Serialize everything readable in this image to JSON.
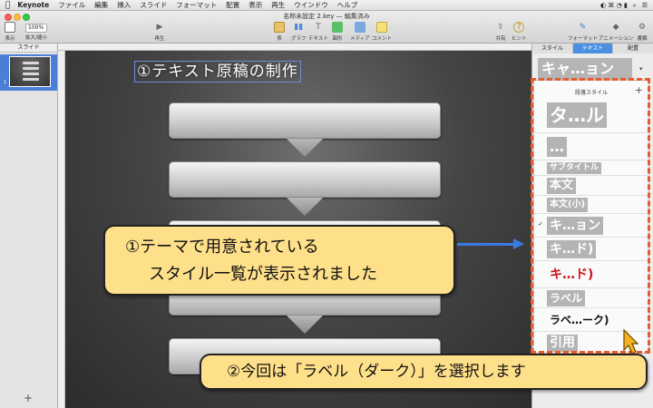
{
  "menubar": {
    "app": "Keynote",
    "items": [
      "ファイル",
      "編集",
      "挿入",
      "スライド",
      "フォーマット",
      "配置",
      "表示",
      "再生",
      "ウインドウ",
      "ヘルプ"
    ]
  },
  "window": {
    "title": "名称未設定 2.key — 編集済み"
  },
  "toolbar": {
    "zoom_value": "100%",
    "view_label": "表示",
    "zoom_label": "拡大/縮小",
    "play_label": "再生",
    "table_label": "表",
    "chart_label": "グラフ",
    "text_label": "テキスト",
    "shape_label": "図形",
    "media_label": "メディア",
    "comment_label": "コメント",
    "share_label": "共有",
    "hint_label": "ヒント",
    "format_label": "フォーマット",
    "animate_label": "アニメーション",
    "document_label": "書類"
  },
  "navigator": {
    "header": "スライド",
    "slide_number": "1",
    "add_label": "+"
  },
  "canvas": {
    "box1_text": "①テキスト原稿の制作"
  },
  "inspector": {
    "tabs": [
      "スタイル",
      "テキスト",
      "配置"
    ],
    "active_tab": "テキスト",
    "current_style": "キャ…ョン",
    "panel_title": "段落スタイル",
    "panel_add": "+",
    "checkmark": "✓",
    "styles": [
      "タ…ル",
      "…",
      "サブタイトル",
      "本文",
      "本文(小)",
      "キ…ョン",
      "キ…ド)",
      "キ…ド)",
      "ラベル",
      "ラベ…ーク)",
      "引用"
    ]
  },
  "annotations": {
    "callout1_line1": "①テーマで用意されている",
    "callout1_line2": "スタイル一覧が表示されました",
    "callout2": "②今回は「ラベル（ダーク）」を選択します"
  },
  "colors": {
    "annotation_fill": "#ffe08a",
    "frame": "#ea5a2a",
    "arrow": "#3a7be0",
    "accent_tab": "#4a90e2",
    "red_style": "#d0141b"
  }
}
